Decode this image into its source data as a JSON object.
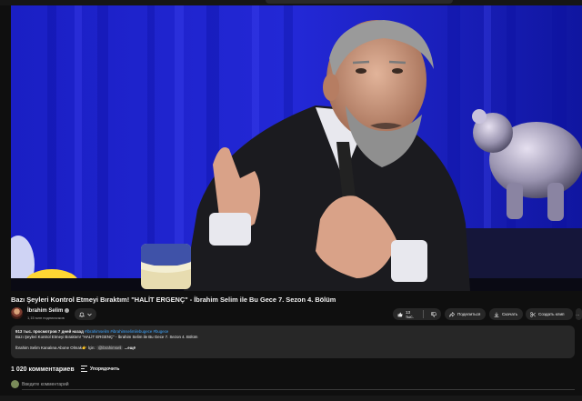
{
  "video": {
    "title": "Bazı Şeyleri Kontrol Etmeyi Bıraktım! \"HALİT ERGENÇ\" - İbrahim Selim ile Bu Gece 7. Sezon 4. Bölüm"
  },
  "channel": {
    "name": "İbrahim Selim",
    "subscribers": "1,15 млн подписчиков"
  },
  "actions": {
    "like_count": "13 тыс.",
    "share_label": "Поделиться",
    "download_label": "Скачать",
    "clip_label": "Создать клип",
    "more_label": "…"
  },
  "description": {
    "meta": "913 тыс. просмотров  7 дней назад",
    "tags": "#ibrahimselim #ibrahimselimilebugece #bugece",
    "line2": "Bazı Şeyleri Kontrol Etmeyi Bıraktım! \"HALİT ERGENÇ\" - İbrahim Selim ile Bu Gece 7. Sezon 4. Bölüm",
    "line3_prefix": "İbrahim Selim Kanalına Abone Olmak👉 İçin:",
    "line3_handle": "@ibrahimseli",
    "more": "...ещё"
  },
  "comments": {
    "count_label": "1 020 комментариев",
    "sort_label": "Упорядочить",
    "input_placeholder": "Введите комментарий"
  }
}
